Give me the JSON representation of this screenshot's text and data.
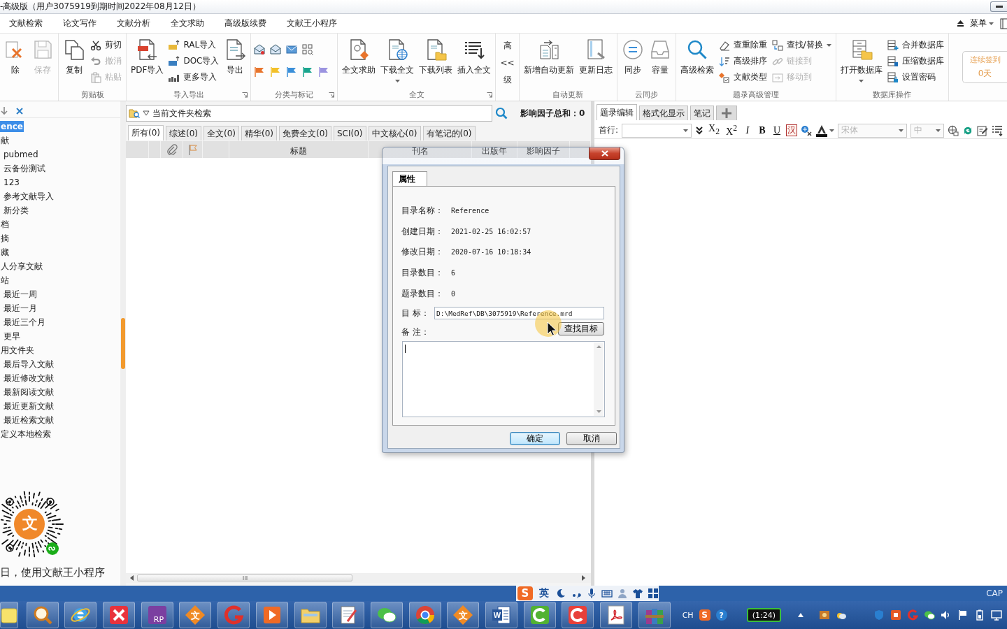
{
  "window": {
    "title": "-高级版（用户3075919到期时间2022年08月12日）"
  },
  "menu_bar": {
    "items": [
      "文献检索",
      "论文写作",
      "文献分析",
      "全文求助",
      "高级版续费",
      "文献王小程序"
    ],
    "menu_button": "菜单"
  },
  "ribbon": {
    "groups": [
      {
        "launcher": false,
        "items": [
          {
            "kind": "large",
            "label": "除",
            "disabled": false,
            "has_menu": false
          },
          {
            "kind": "large",
            "label": "保存",
            "disabled": true,
            "has_menu": false
          }
        ]
      },
      {
        "label": "剪贴板",
        "launcher": false,
        "items": [
          {
            "kind": "large",
            "label": "复制",
            "disabled": false,
            "has_menu": false
          },
          {
            "kind": "stack",
            "buttons": [
              {
                "label": "剪切",
                "disabled": false,
                "has_menu": false
              },
              {
                "label": "撤消",
                "disabled": true,
                "has_menu": false
              },
              {
                "label": "粘贴",
                "disabled": true,
                "has_menu": false
              }
            ]
          }
        ]
      },
      {
        "label": "导入导出",
        "launcher": true,
        "items": [
          {
            "kind": "large",
            "label": "PDF导入",
            "disabled": false,
            "has_menu": false
          },
          {
            "kind": "stack",
            "buttons": [
              {
                "label": "RAL导入",
                "disabled": false,
                "has_menu": false
              },
              {
                "label": "DOC导入",
                "disabled": false,
                "has_menu": false
              },
              {
                "label": "更多导入",
                "disabled": false,
                "has_menu": false
              }
            ]
          },
          {
            "kind": "large",
            "label": "导出",
            "disabled": false,
            "has_menu": false
          }
        ]
      },
      {
        "label": "分类与标记",
        "launcher": true,
        "items": [
          {
            "kind": "marks",
            "flags": [
              {
                "color": "#e8742c"
              },
              {
                "color": "#f2c029"
              },
              {
                "color": "#3a8fd9"
              },
              {
                "color": "#1aa58e"
              },
              {
                "color": "#9b93e0"
              }
            ]
          }
        ]
      },
      {
        "label": "全文",
        "launcher": true,
        "items": [
          {
            "kind": "large",
            "label": "全文求助",
            "disabled": false,
            "has_menu": false
          },
          {
            "kind": "large",
            "label": "下载全文",
            "disabled": false,
            "has_menu": true
          },
          {
            "kind": "large",
            "label": "下载列表",
            "disabled": false,
            "has_menu": false
          },
          {
            "kind": "large",
            "label": "插入全文",
            "disabled": false,
            "has_menu": false
          }
        ]
      },
      {
        "launcher": false,
        "items": [
          {
            "kind": "collapsed",
            "top": "高",
            "arrow": "<<",
            "bottom": "级"
          }
        ]
      },
      {
        "label": "自动更新",
        "launcher": false,
        "items": [
          {
            "kind": "large",
            "label": "新增自动更新",
            "disabled": false,
            "has_menu": false
          },
          {
            "kind": "large",
            "label": "更新日志",
            "disabled": false,
            "has_menu": false
          }
        ]
      },
      {
        "label": "云同步",
        "launcher": false,
        "items": [
          {
            "kind": "large",
            "label": "同步",
            "disabled": false,
            "has_menu": false
          },
          {
            "kind": "large",
            "label": "容量",
            "disabled": false,
            "has_menu": false
          }
        ]
      },
      {
        "label": "题录高级管理",
        "launcher": false,
        "items": [
          {
            "kind": "large",
            "label": "高级检索",
            "disabled": false,
            "has_menu": false
          },
          {
            "kind": "stack",
            "buttons": [
              {
                "label": "查重除重",
                "disabled": false,
                "has_menu": false
              },
              {
                "label": "高级排序",
                "disabled": false,
                "has_menu": false
              },
              {
                "label": "文献类型",
                "disabled": false,
                "has_menu": false
              }
            ]
          },
          {
            "kind": "stack",
            "buttons": [
              {
                "label": "查找/替换",
                "disabled": false,
                "has_menu": true
              },
              {
                "label": "链接到",
                "disabled": true,
                "has_menu": false
              },
              {
                "label": "移动到",
                "disabled": true,
                "has_menu": false
              }
            ]
          }
        ]
      },
      {
        "label": "数据库操作",
        "launcher": false,
        "items": [
          {
            "kind": "large",
            "label": "打开数据库",
            "disabled": false,
            "has_menu": true
          },
          {
            "kind": "stack",
            "buttons": [
              {
                "label": "合并数据库",
                "disabled": false,
                "has_menu": false
              },
              {
                "label": "压缩数据库",
                "disabled": false,
                "has_menu": false
              },
              {
                "label": "设置密码",
                "disabled": false,
                "has_menu": false
              }
            ]
          }
        ]
      }
    ],
    "sign_in": {
      "title": "连续签到",
      "value": "0天"
    }
  },
  "sidebar": {
    "tree": [
      {
        "label": "ence",
        "selected": true
      },
      {
        "label": "献",
        "selected": false,
        "children": [
          {
            "label": "pubmed",
            "selected": false
          },
          {
            "label": "云备份测试",
            "selected": false
          },
          {
            "label": "123",
            "selected": false
          },
          {
            "label": "参考文献导入",
            "selected": false
          },
          {
            "label": "新分类",
            "selected": false
          }
        ]
      },
      {
        "label": "档",
        "selected": false
      },
      {
        "label": "摘",
        "selected": false
      },
      {
        "label": "藏",
        "selected": false
      },
      {
        "label": "人分享文献",
        "selected": false
      },
      {
        "label": "站",
        "selected": false,
        "children": [
          {
            "label": "最近一周",
            "selected": false
          },
          {
            "label": "最近一月",
            "selected": false
          },
          {
            "label": "最近三个月",
            "selected": false
          },
          {
            "label": "更早",
            "selected": false
          }
        ]
      },
      {
        "label": "用文件夹",
        "selected": false,
        "children": [
          {
            "label": "最后导入文献",
            "selected": false
          },
          {
            "label": "最近修改文献",
            "selected": false
          },
          {
            "label": "最新阅读文献",
            "selected": false
          },
          {
            "label": "最近更新文献",
            "selected": false
          },
          {
            "label": "最近检索文献",
            "selected": false
          }
        ]
      },
      {
        "label": "定义本地检索",
        "selected": false
      }
    ],
    "qr_logo": "文",
    "qr_caption": "日，使用文献王小程序"
  },
  "list_panel": {
    "search": {
      "value": "当前文件夹检索"
    },
    "impact_total": "影响因子总和：0",
    "tabs": [
      {
        "label": "所有(0)",
        "selected": true
      },
      {
        "label": "综述(0)",
        "selected": false
      },
      {
        "label": "全文(0)",
        "selected": false
      },
      {
        "label": "精华(0)",
        "selected": false
      },
      {
        "label": "免费全文(0)",
        "selected": false
      },
      {
        "label": "SCI(0)",
        "selected": false
      },
      {
        "label": "中文核心(0)",
        "selected": false
      },
      {
        "label": "有笔记的(0)",
        "selected": false
      }
    ],
    "columns": [
      {
        "kind": "blank"
      },
      {
        "kind": "blank"
      },
      {
        "kind": "attachment"
      },
      {
        "kind": "flag"
      },
      {
        "kind": "blank"
      },
      {
        "kind": "text",
        "label": "标题"
      },
      {
        "kind": "text",
        "label": "刊名"
      },
      {
        "kind": "text",
        "label": "出版年"
      },
      {
        "kind": "text",
        "label": "影响因子"
      },
      {
        "kind": "blank"
      }
    ]
  },
  "editor": {
    "tabs": [
      {
        "label": "题录编辑",
        "selected": true
      },
      {
        "label": "格式化显示",
        "selected": false
      },
      {
        "label": "笔记",
        "selected": false
      }
    ],
    "first_line_label": "首行:",
    "tools": [
      {
        "kind": "collapse"
      },
      {
        "kind": "sub",
        "text": "X$_{2}$"
      },
      {
        "kind": "sup",
        "text": "X$^{2}$"
      },
      {
        "kind": "italic",
        "text": "I"
      },
      {
        "kind": "bold",
        "text": "B"
      },
      {
        "kind": "underline",
        "text": "U"
      },
      {
        "kind": "boxed",
        "text": "汉"
      },
      {
        "kind": "translate"
      },
      {
        "kind": "font_color"
      }
    ],
    "font": {
      "value": "宋体",
      "disabled": true
    },
    "size": {
      "value": "中",
      "disabled": true
    },
    "tools_end": [
      {
        "kind": "globe"
      },
      {
        "kind": "sync"
      },
      {
        "kind": "edit"
      },
      {
        "kind": "list"
      }
    ]
  },
  "dialog": {
    "tabs": [
      {
        "label": "属性",
        "selected": true
      }
    ],
    "fields": [
      {
        "label": "目录名称：",
        "value": "Reference"
      },
      {
        "label": "创建日期：",
        "value": "2021-02-25 16:02:57"
      },
      {
        "label": "修改日期：",
        "value": "2020-07-16 10:18:34"
      },
      {
        "label": "目录数目：",
        "value": "6"
      },
      {
        "label": "题录数目：",
        "value": "0"
      }
    ],
    "target": {
      "label": "目 标：",
      "value": "D:\\MedRef\\DB\\3075919\\Reference.mrd"
    },
    "find_button": "查找目标",
    "note": {
      "label": "备 注："
    },
    "buttons": [
      {
        "label": "确定",
        "default": true
      },
      {
        "label": "取消",
        "default": false
      }
    ]
  },
  "ime": {
    "logo": "S",
    "mode": "英"
  },
  "status": {
    "caps": "CAP"
  },
  "taskbar": {
    "apps": [
      {
        "kind": "note"
      },
      {
        "kind": "magnifier"
      },
      {
        "kind": "globe"
      },
      {
        "kind": "cross"
      },
      {
        "kind": "rp",
        "glyph": "RP"
      },
      {
        "kind": "diamond",
        "glyph": "文"
      },
      {
        "kind": "swirl"
      },
      {
        "kind": "play"
      },
      {
        "kind": "folder"
      },
      {
        "kind": "notepad"
      },
      {
        "kind": "chat"
      },
      {
        "kind": "ring"
      },
      {
        "kind": "diamond",
        "glyph": "文"
      },
      {
        "kind": "worddoc",
        "glyph": "W"
      },
      {
        "kind": "cgreen"
      },
      {
        "kind": "cred"
      },
      {
        "kind": "pdf"
      },
      {
        "kind": "books"
      }
    ],
    "tray": [
      {
        "kind": "label",
        "text": "CH"
      },
      {
        "kind": "slogo",
        "text": "S"
      },
      {
        "kind": "help",
        "text": "?"
      },
      {
        "kind": "timer",
        "text": "(1:24)"
      }
    ]
  }
}
